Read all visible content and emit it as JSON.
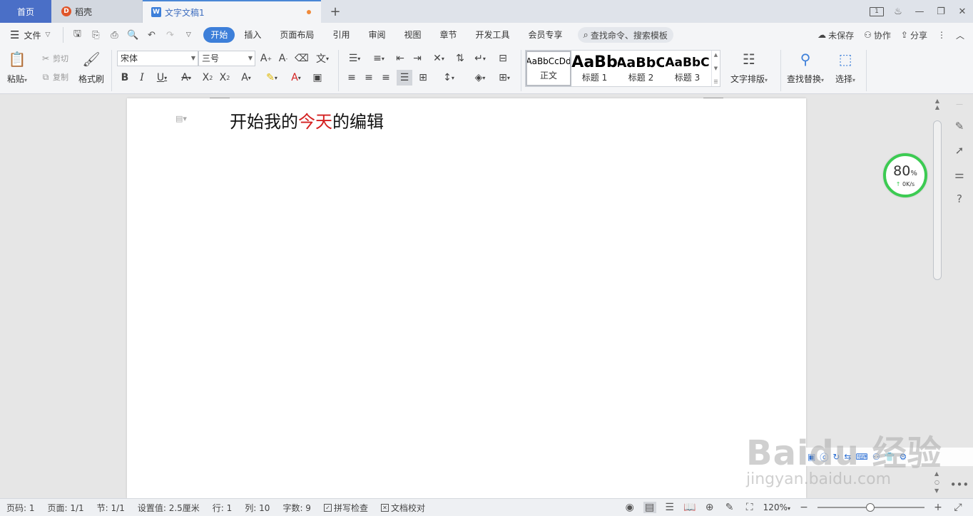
{
  "tabs": {
    "home": "首页",
    "daoke": "稻壳",
    "doc": "文字文稿1",
    "add": "+"
  },
  "titlebar": {
    "window_count": "1",
    "minimize": "—",
    "restore": "❐",
    "close": "✕"
  },
  "menu": {
    "file": "文件",
    "tabs": [
      "开始",
      "插入",
      "页面布局",
      "引用",
      "审阅",
      "视图",
      "章节",
      "开发工具",
      "会员专享"
    ],
    "search": "查找命令、搜索模板",
    "unsaved": "未保存",
    "collab": "协作",
    "share": "分享"
  },
  "ribbon": {
    "paste": "粘贴",
    "cut": "剪切",
    "copy": "复制",
    "format_painter": "格式刷",
    "font_name": "宋体",
    "font_size": "三号",
    "styles": [
      {
        "sample": "AaBbCcDd",
        "name": "正文"
      },
      {
        "sample": "AaBb",
        "name": "标题 1"
      },
      {
        "sample": "AaBbC",
        "name": "标题 2"
      },
      {
        "sample": "AaBbC",
        "name": "标题 3"
      }
    ],
    "text_layout": "文字排版",
    "find_replace": "查找替换",
    "select": "选择"
  },
  "document": {
    "text_before": "开始我的",
    "text_red": "今天",
    "text_after": "的编辑",
    "highlight_color": "#d42020"
  },
  "speed_widget": {
    "percent": "80",
    "percent_unit": "%",
    "rate": "0K/s"
  },
  "status": {
    "page_num": "页码: 1",
    "pages": "页面: 1/1",
    "section": "节: 1/1",
    "setting": "设置值: 2.5厘米",
    "row": "行: 1",
    "col": "列: 10",
    "word_count": "字数: 9",
    "spell_check": "拼写检查",
    "doc_proof": "文档校对",
    "zoom": "120%"
  },
  "watermark": {
    "line1": "Baidu 经验",
    "line2": "jingyan.baidu.com"
  }
}
